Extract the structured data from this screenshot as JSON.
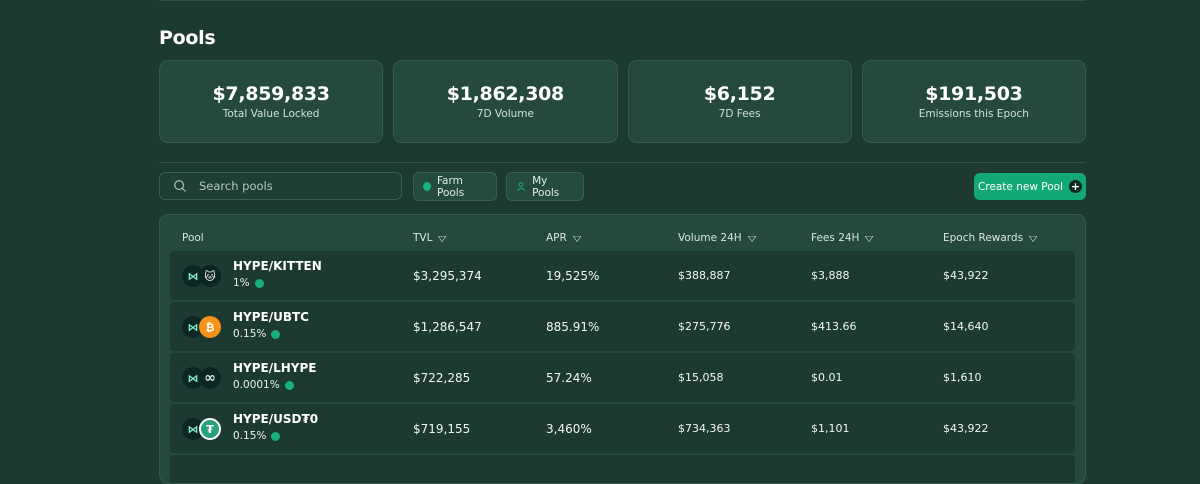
{
  "page": {
    "title": "Pools"
  },
  "stats": [
    {
      "value": "$7,859,833",
      "label": "Total Value Locked"
    },
    {
      "value": "$1,862,308",
      "label": "7D Volume"
    },
    {
      "value": "$6,152",
      "label": "7D Fees"
    },
    {
      "value": "$191,503",
      "label": "Emissions this Epoch"
    }
  ],
  "toolbar": {
    "search_placeholder": "Search pools",
    "farm_pools_label": "Farm Pools",
    "my_pools_label": "My Pools",
    "create_pool_label": "Create new Pool"
  },
  "table": {
    "columns": [
      "Pool",
      "TVL",
      "APR",
      "Volume 24H",
      "Fees 24H",
      "Epoch Rewards"
    ],
    "rows": [
      {
        "pair": "HYPE/KITTEN",
        "fee": "1%",
        "token_icon": "kitten-icon",
        "tvl": "$3,295,374",
        "apr": "19,525%",
        "volume": "$388,887",
        "fees": "$3,888",
        "rewards": "$43,922"
      },
      {
        "pair": "HYPE/UBTC",
        "fee": "0.15%",
        "token_icon": "bitcoin-icon",
        "tvl": "$1,286,547",
        "apr": "885.91%",
        "volume": "$275,776",
        "fees": "$413.66",
        "rewards": "$14,640"
      },
      {
        "pair": "HYPE/LHYPE",
        "fee": "0.0001%",
        "token_icon": "infinity-icon",
        "tvl": "$722,285",
        "apr": "57.24%",
        "volume": "$15,058",
        "fees": "$0.01",
        "rewards": "$1,610"
      },
      {
        "pair": "HYPE/USD₮0",
        "fee": "0.15%",
        "token_icon": "usdt-icon",
        "tvl": "$719,155",
        "apr": "3,460%",
        "volume": "$734,363",
        "fees": "$1,101",
        "rewards": "$43,922"
      }
    ]
  },
  "colors": {
    "background": "#1d3a32",
    "card": "#25493f",
    "row": "#1c3a32",
    "accent": "#13a877",
    "status_dot": "#18b07c"
  }
}
